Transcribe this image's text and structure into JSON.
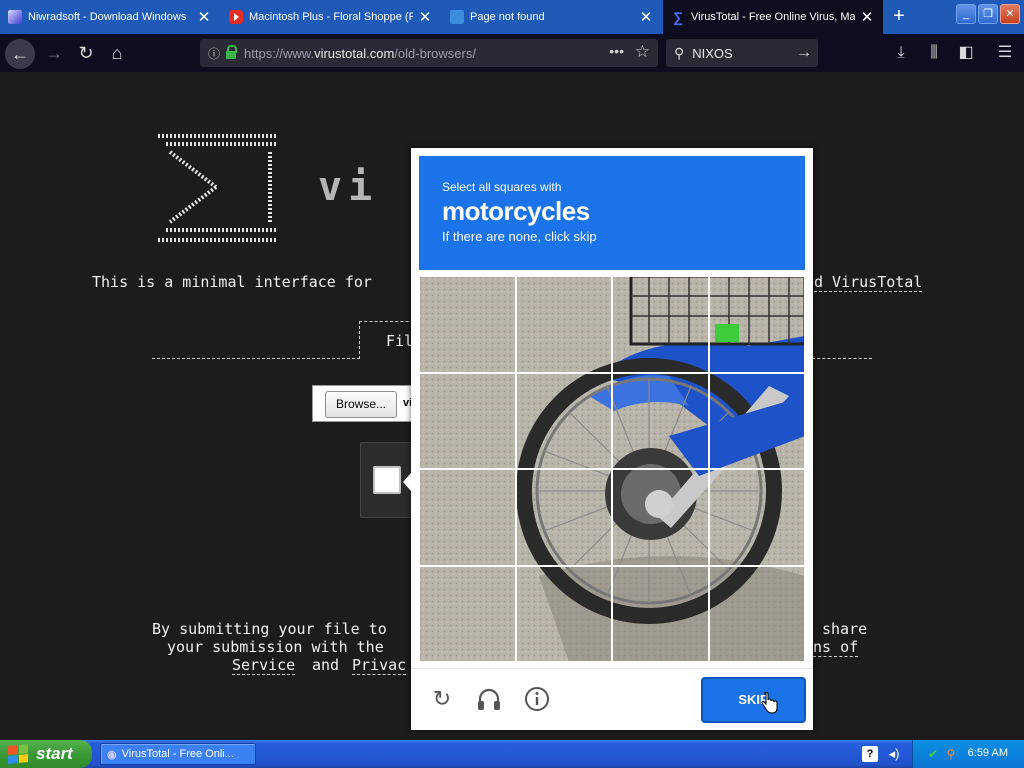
{
  "browser": {
    "tabs": [
      {
        "title": "Niwradsoft - Download Windows",
        "favicon": "niwradsoft-icon",
        "active": false
      },
      {
        "title": "Macintosh Plus - Floral Shoppe (F",
        "favicon": "youtube-icon",
        "active": false
      },
      {
        "title": "Page not found",
        "favicon": "page-icon",
        "active": false
      },
      {
        "title": "VirusTotal - Free Online Virus, Ma",
        "favicon": "virustotal-icon",
        "active": true
      }
    ],
    "url": {
      "prefix": "https://www.",
      "domain": "virustotal.com",
      "path": "/old-browsers/"
    },
    "search_value": "NIXOS"
  },
  "page": {
    "intro_text": "This is a minimal interface for",
    "intro_link": "d VirusTotal",
    "file_label": "Fil",
    "browse_button": "Browse...",
    "file_name_fragment": "vi",
    "terms": {
      "line1_start": "By submitting your file to",
      "line1_end": "share",
      "line2_start": "your submission with the",
      "line2_end": "ns of",
      "line3_service": "Service",
      "line3_and": "and",
      "line3_privacy": "Privac"
    }
  },
  "captcha": {
    "prompt_line1": "Select all squares with",
    "prompt_keyword": "motorcycles",
    "prompt_line3": "If there are none, click skip",
    "skip_button": "SKIP",
    "footer_icons": [
      "refresh-icon",
      "audio-challenge-icon",
      "info-icon"
    ],
    "accent_color": "#1a73e8"
  },
  "taskbar": {
    "start_label": "start",
    "task_label": "VirusTotal - Free Onli...",
    "clock": "6:59 AM"
  }
}
